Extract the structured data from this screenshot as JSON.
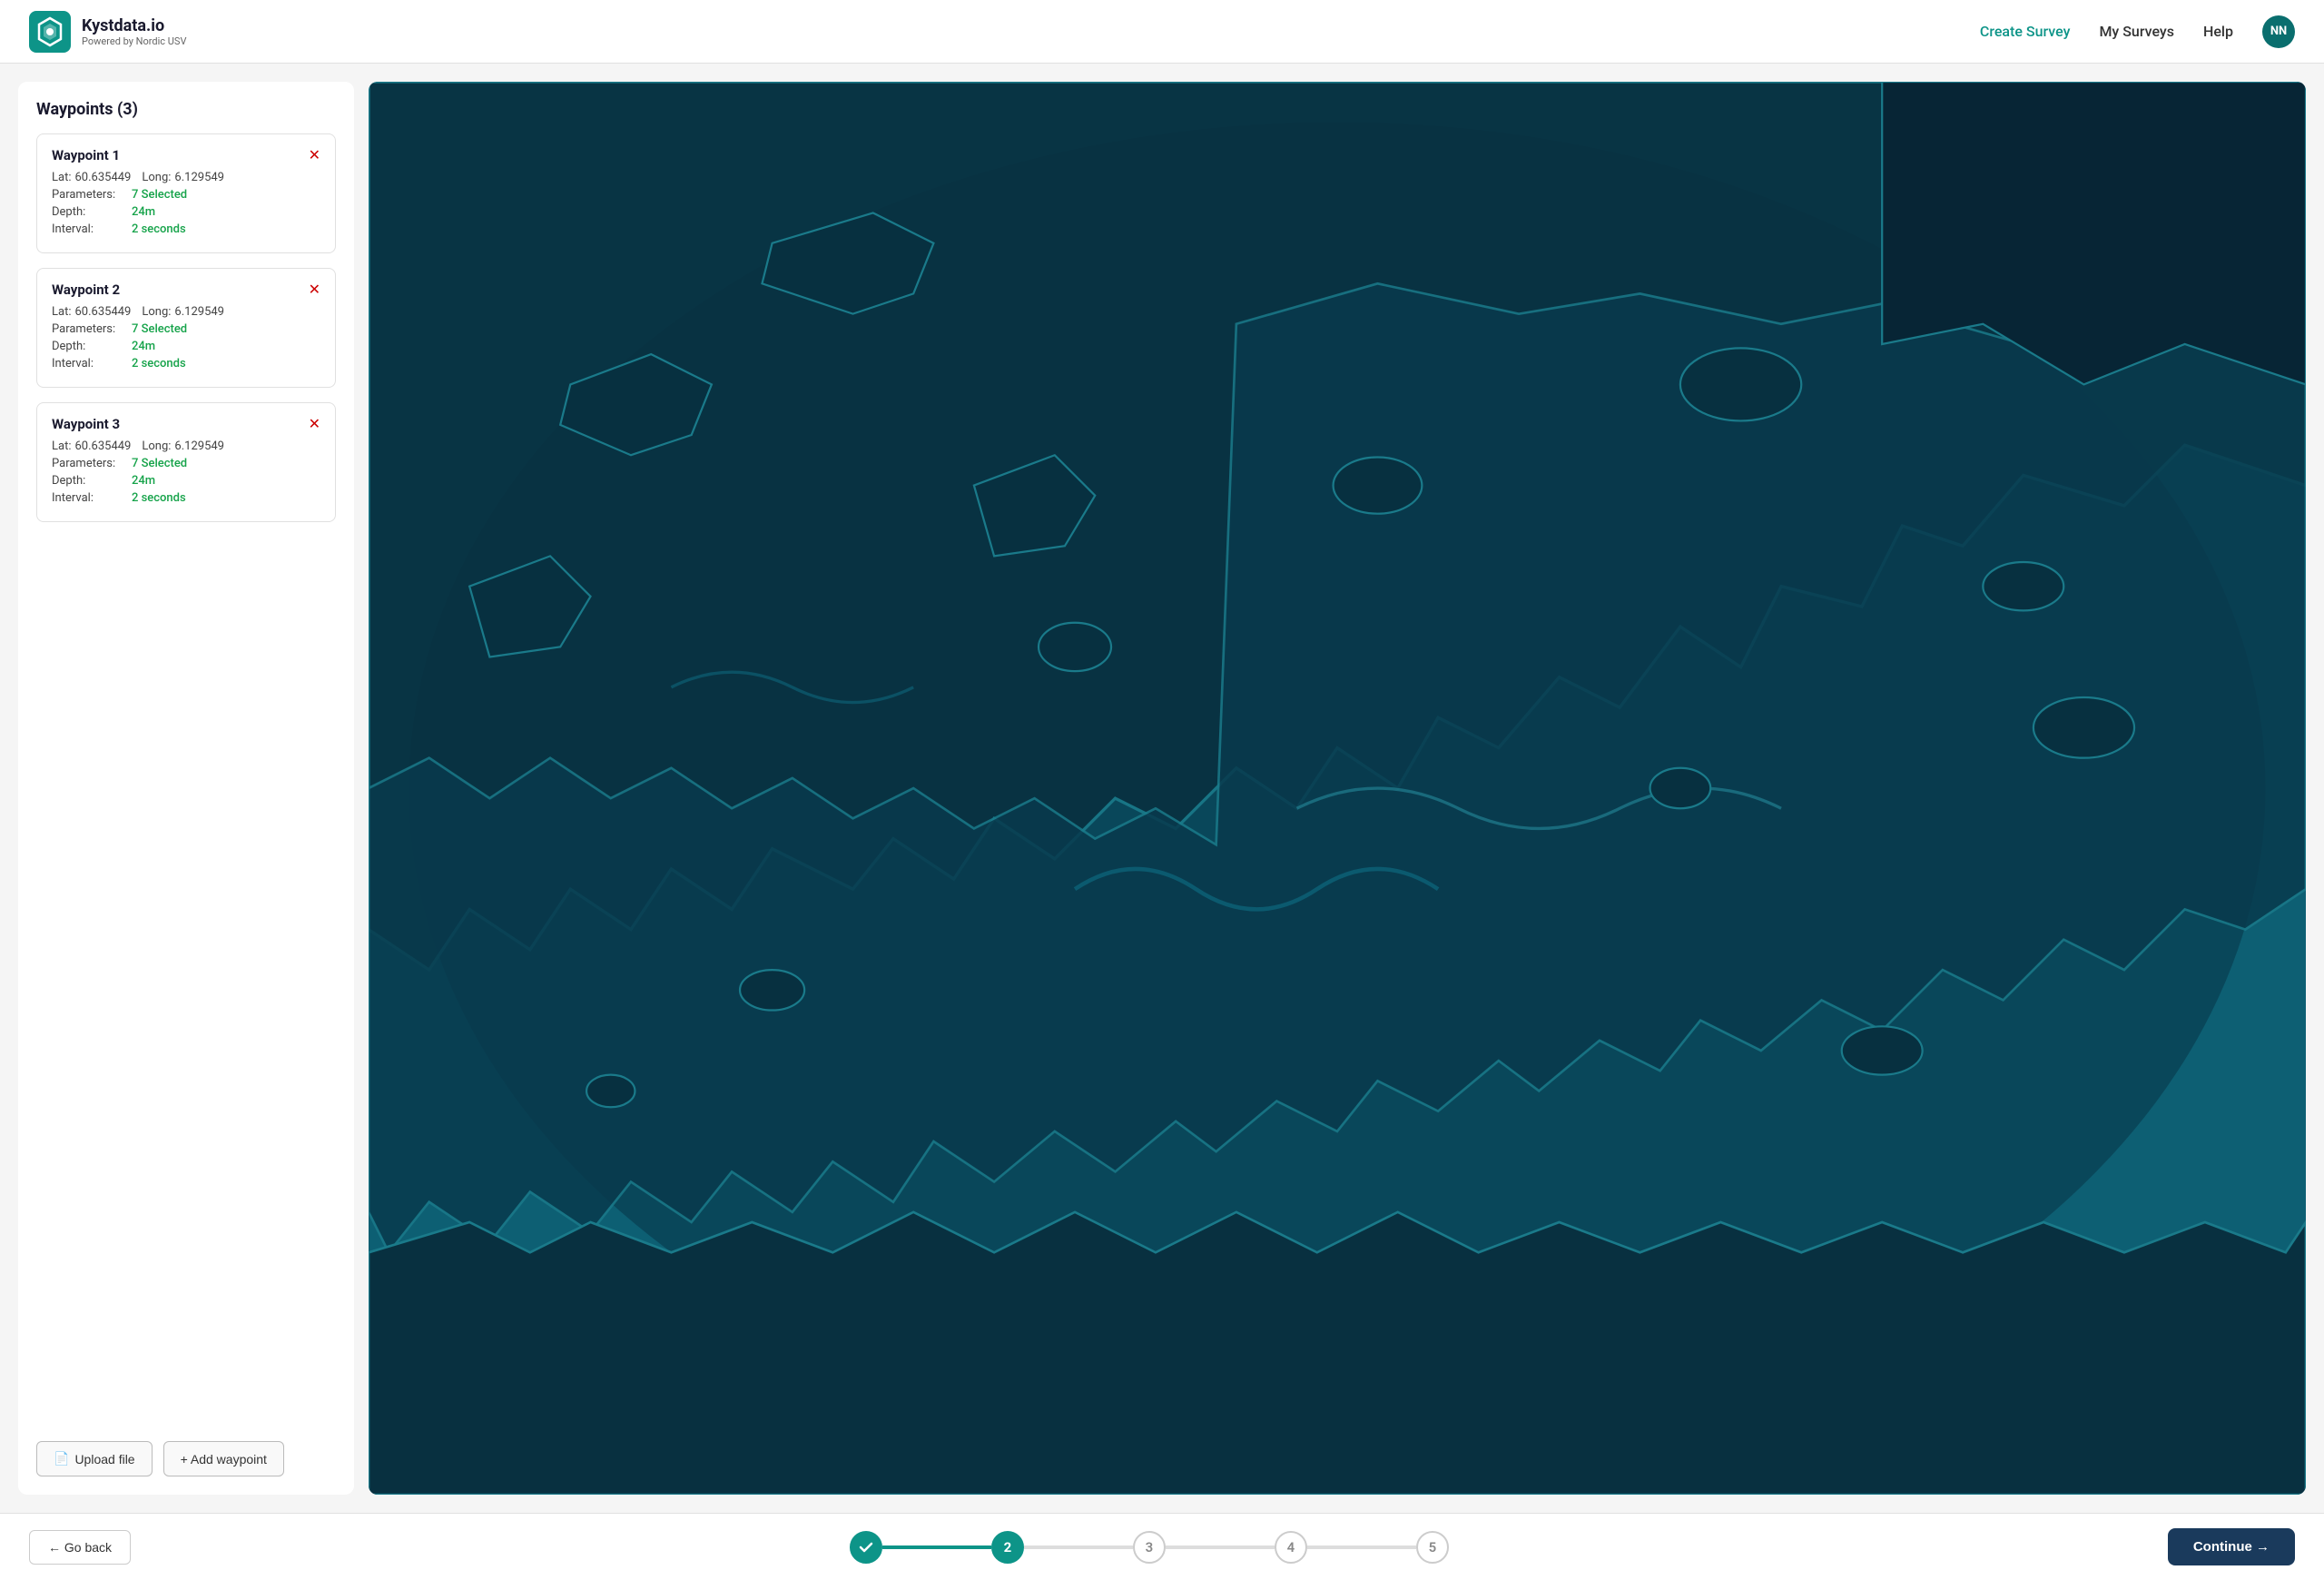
{
  "header": {
    "logo_title": "Kystdata.io",
    "logo_subtitle": "Powered by Nordic USV",
    "nav_create": "Create Survey",
    "nav_my_surveys": "My Surveys",
    "nav_help": "Help",
    "avatar_initials": "NN"
  },
  "sidebar": {
    "title": "Waypoints (3)",
    "waypoints": [
      {
        "title": "Waypoint 1",
        "lat_label": "Lat:",
        "lat_value": "60.635449",
        "long_label": "Long:",
        "long_value": "6.129549",
        "params_label": "Parameters:",
        "params_value": "7 Selected",
        "depth_label": "Depth:",
        "depth_value": "24m",
        "interval_label": "Interval:",
        "interval_value": "2 seconds"
      },
      {
        "title": "Waypoint 2",
        "lat_label": "Lat:",
        "lat_value": "60.635449",
        "long_label": "Long:",
        "long_value": "6.129549",
        "params_label": "Parameters:",
        "params_value": "7 Selected",
        "depth_label": "Depth:",
        "depth_value": "24m",
        "interval_label": "Interval:",
        "interval_value": "2 seconds"
      },
      {
        "title": "Waypoint 3",
        "lat_label": "Lat:",
        "lat_value": "60.635449",
        "long_label": "Long:",
        "long_value": "6.129549",
        "params_label": "Parameters:",
        "params_value": "7 Selected",
        "depth_label": "Depth:",
        "depth_value": "24m",
        "interval_label": "Interval:",
        "interval_value": "2 seconds"
      }
    ],
    "upload_button": "Upload file",
    "add_button": "+ Add waypoint"
  },
  "stepper": {
    "go_back": "← Go back",
    "continue": "Continue →",
    "steps": [
      {
        "number": "✓",
        "state": "done"
      },
      {
        "number": "2",
        "state": "active"
      },
      {
        "number": "3",
        "state": "inactive"
      },
      {
        "number": "4",
        "state": "inactive"
      },
      {
        "number": "5",
        "state": "inactive"
      }
    ]
  },
  "map": {
    "bg_color": "#0a4a5c",
    "ocean_color": "#0d5f73",
    "land_color": "#0a3d4d"
  }
}
